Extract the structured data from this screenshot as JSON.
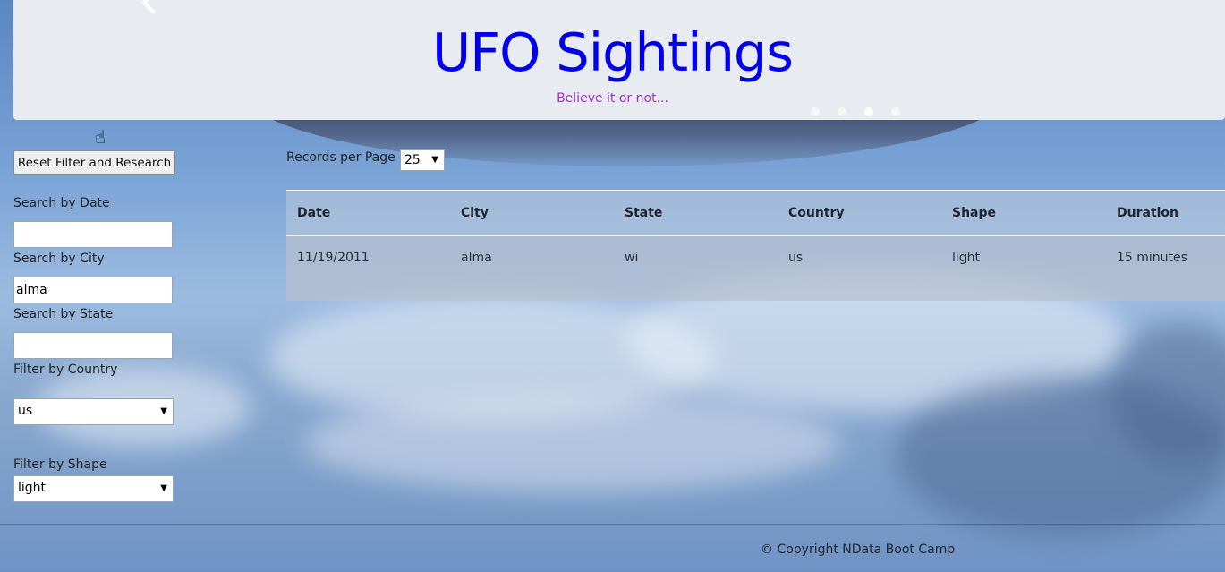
{
  "header": {
    "title": "UFO Sightings",
    "subtitle": "Believe it or not..."
  },
  "sidebar": {
    "reset_label": "Reset Filter and Research",
    "date_label": "Search by Date",
    "date_value": "",
    "city_label": "Search by City",
    "city_value": "alma",
    "state_label": "Search by State",
    "state_value": "",
    "country_label": "Filter by Country",
    "country_value": "us",
    "shape_label": "Filter by Shape",
    "shape_value": "light"
  },
  "pagination": {
    "records_label": "Records per Page",
    "records_value": "25"
  },
  "table": {
    "columns": [
      "Date",
      "City",
      "State",
      "Country",
      "Shape",
      "Duration"
    ],
    "rows": [
      [
        "11/19/2011",
        "alma",
        "wi",
        "us",
        "light",
        "15 minutes"
      ]
    ]
  },
  "footer": {
    "copyright": "© Copyright NData Boot Camp"
  }
}
